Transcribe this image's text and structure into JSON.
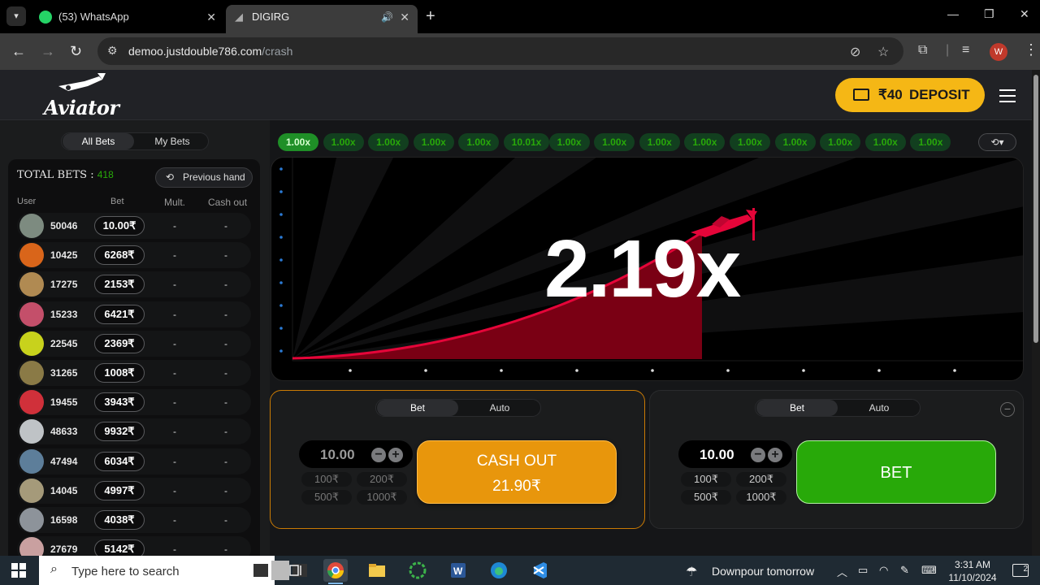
{
  "browser": {
    "tabs": [
      {
        "title": "(53) WhatsApp",
        "active": false
      },
      {
        "title": "DIGIRG",
        "active": true
      }
    ],
    "url_host": "demoo.justdouble786.com",
    "url_path": "/crash",
    "profile_initial": "W"
  },
  "header": {
    "logo_text": "Aviator",
    "deposit_amount": "₹40",
    "deposit_label": "DEPOSIT"
  },
  "bets_panel": {
    "tab_all": "All Bets",
    "tab_my": "My Bets",
    "total_label": "TOTAL BETS :",
    "total_value": "418",
    "previous_hand": "Previous hand",
    "col_user": "User",
    "col_bet": "Bet",
    "col_mult": "Mult.",
    "col_cashout": "Cash out",
    "rows": [
      {
        "user": "50046",
        "bet": "10.00₹",
        "mult": "-",
        "cashout": "-",
        "avatar": "#7d8b80"
      },
      {
        "user": "10425",
        "bet": "6268₹",
        "mult": "-",
        "cashout": "-",
        "avatar": "#d9651a"
      },
      {
        "user": "17275",
        "bet": "2153₹",
        "mult": "-",
        "cashout": "-",
        "avatar": "#b08a52"
      },
      {
        "user": "15233",
        "bet": "6421₹",
        "mult": "-",
        "cashout": "-",
        "avatar": "#c44f6a"
      },
      {
        "user": "22545",
        "bet": "2369₹",
        "mult": "-",
        "cashout": "-",
        "avatar": "#c8d21c"
      },
      {
        "user": "31265",
        "bet": "1008₹",
        "mult": "-",
        "cashout": "-",
        "avatar": "#8a7a46"
      },
      {
        "user": "19455",
        "bet": "3943₹",
        "mult": "-",
        "cashout": "-",
        "avatar": "#d0303a"
      },
      {
        "user": "48633",
        "bet": "9932₹",
        "mult": "-",
        "cashout": "-",
        "avatar": "#bfc3c6"
      },
      {
        "user": "47494",
        "bet": "6034₹",
        "mult": "-",
        "cashout": "-",
        "avatar": "#5d7e9a"
      },
      {
        "user": "14045",
        "bet": "4997₹",
        "mult": "-",
        "cashout": "-",
        "avatar": "#a59a7a"
      },
      {
        "user": "16598",
        "bet": "4038₹",
        "mult": "-",
        "cashout": "-",
        "avatar": "#8d939a"
      },
      {
        "user": "27679",
        "bet": "5142₹",
        "mult": "-",
        "cashout": "-",
        "avatar": "#c9a0a0"
      }
    ]
  },
  "history": [
    "1.00x",
    "1.00x",
    "1.00x",
    "1.00x",
    "1.00x",
    "10.01x",
    "1.00x",
    "1.00x",
    "1.00x",
    "1.00x",
    "1.00x",
    "1.00x",
    "1.00x",
    "1.00x",
    "1.00x"
  ],
  "game": {
    "multiplier": "2.19x",
    "curve_color": "#e50539"
  },
  "bet_panels": [
    {
      "tab_bet": "Bet",
      "tab_auto": "Auto",
      "amount": "10.00",
      "quick": [
        "100₹",
        "200₹",
        "500₹",
        "1000₹"
      ],
      "action_line1": "CASH OUT",
      "action_line2": "21.90₹",
      "action_color": "#e8960c"
    },
    {
      "tab_bet": "Bet",
      "tab_auto": "Auto",
      "amount": "10.00",
      "quick": [
        "100₹",
        "200₹",
        "500₹",
        "1000₹"
      ],
      "action_line1": "BET",
      "action_color": "#28a909"
    }
  ],
  "taskbar": {
    "search_placeholder": "Type here to search",
    "weather": "Downpour tomorrow",
    "time": "3:31 AM",
    "date": "11/10/2024",
    "notifications": "2"
  }
}
